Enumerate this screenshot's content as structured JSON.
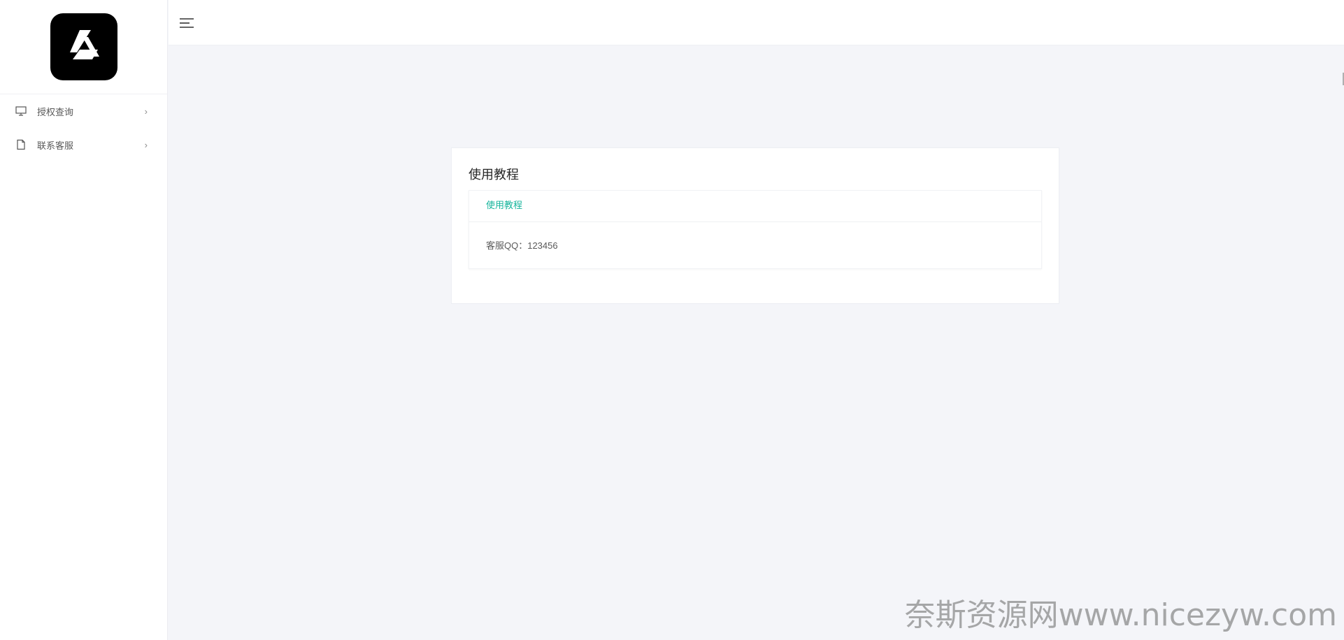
{
  "sidebar": {
    "logo_icon": "google-drive-style-logo-icon",
    "items": [
      {
        "label": "授权查询",
        "icon": "monitor-icon"
      },
      {
        "label": "联系客服",
        "icon": "document-icon"
      }
    ]
  },
  "topbar": {
    "menu_icon": "hamburger-menu-icon"
  },
  "card": {
    "title": "使用教程",
    "panel_header": "使用教程",
    "panel_body": "客服QQ：123456"
  },
  "watermark": "奈斯资源网www.nicezyw.com",
  "colors": {
    "accent": "#16b59c",
    "background": "#f4f5f9",
    "logo_bg": "#000000"
  }
}
